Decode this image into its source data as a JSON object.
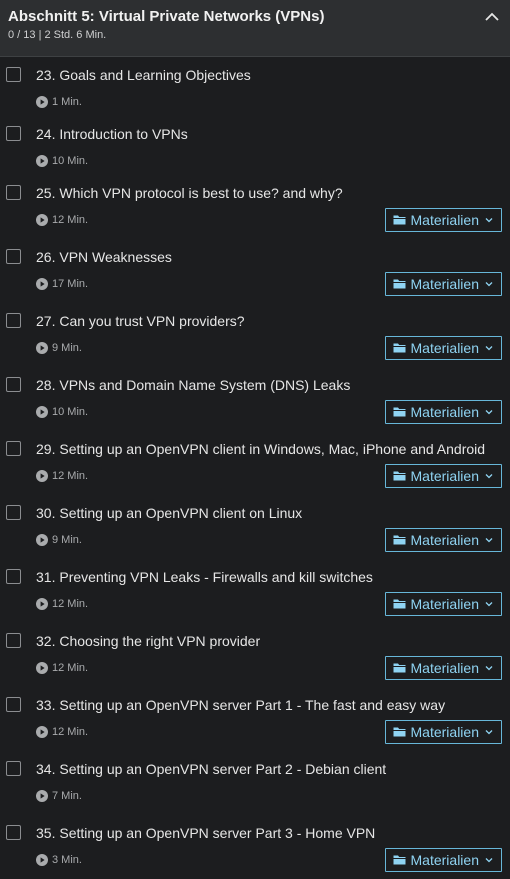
{
  "section": {
    "title": "Abschnitt 5: Virtual Private Networks (VPNs)",
    "meta": "0 / 13 | 2 Std. 6 Min."
  },
  "resources_label": "Materialien",
  "lectures": [
    {
      "title": "23. Goals and Learning Objectives",
      "duration": "1 Min.",
      "resources": false
    },
    {
      "title": "24. Introduction to VPNs",
      "duration": "10 Min.",
      "resources": false
    },
    {
      "title": "25. Which VPN protocol is best to use? and why?",
      "duration": "12 Min.",
      "resources": true
    },
    {
      "title": "26. VPN Weaknesses",
      "duration": "17 Min.",
      "resources": true
    },
    {
      "title": "27. Can you trust VPN providers?",
      "duration": "9 Min.",
      "resources": true
    },
    {
      "title": "28. VPNs and Domain Name System (DNS) Leaks",
      "duration": "10 Min.",
      "resources": true
    },
    {
      "title": "29. Setting up an OpenVPN client in Windows, Mac, iPhone and Android",
      "duration": "12 Min.",
      "resources": true
    },
    {
      "title": "30. Setting up an OpenVPN client on Linux",
      "duration": "9 Min.",
      "resources": true
    },
    {
      "title": "31. Preventing VPN Leaks - Firewalls and kill switches",
      "duration": "12 Min.",
      "resources": true
    },
    {
      "title": "32. Choosing the right VPN provider",
      "duration": "12 Min.",
      "resources": true
    },
    {
      "title": "33. Setting up an OpenVPN server Part 1 - The fast and easy way",
      "duration": "12 Min.",
      "resources": true
    },
    {
      "title": "34. Setting up an OpenVPN server Part 2 - Debian client",
      "duration": "7 Min.",
      "resources": false
    },
    {
      "title": "35. Setting up an OpenVPN server Part 3 - Home VPN",
      "duration": "3 Min.",
      "resources": true
    }
  ],
  "colors": {
    "accent": "#8fd3f2",
    "background": "#1c1d1f",
    "header": "#2d2f31"
  },
  "icons": {
    "collapse": "chevron-up-icon",
    "play": "play-circle-icon",
    "folder": "folder-icon",
    "dropdown": "chevron-down-icon"
  }
}
